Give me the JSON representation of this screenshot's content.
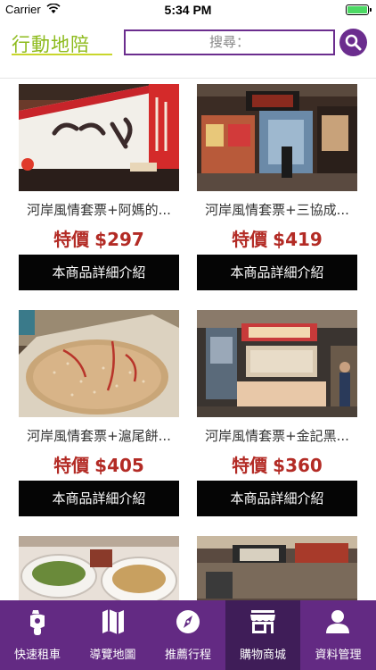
{
  "status_bar": {
    "carrier": "Carrier",
    "time": "5:34 PM"
  },
  "header": {
    "logo_text": "行動地陪",
    "search_placeholder": "搜尋："
  },
  "products": [
    {
      "name": "河岸風情套票+阿媽的...",
      "price_label": "特價",
      "price": "$297",
      "button": "本商品詳細介紹",
      "image": "shop-sign"
    },
    {
      "name": "河岸風情套票+三協成...",
      "price_label": "特價",
      "price": "$419",
      "button": "本商品詳細介紹",
      "image": "shop-front"
    },
    {
      "name": "河岸風情套票+滬尾餅...",
      "price_label": "特價",
      "price": "$405",
      "button": "本商品詳細介紹",
      "image": "cake"
    },
    {
      "name": "河岸風情套票+金記黑...",
      "price_label": "特價",
      "price": "$360",
      "button": "本商品詳細介紹",
      "image": "store-counter"
    }
  ],
  "tabs": [
    {
      "label": "快速租車",
      "icon": "scooter-icon"
    },
    {
      "label": "導覽地圖",
      "icon": "map-icon"
    },
    {
      "label": "推薦行程",
      "icon": "compass-icon"
    },
    {
      "label": "購物商城",
      "icon": "store-icon",
      "active": true
    },
    {
      "label": "資料管理",
      "icon": "user-icon"
    }
  ],
  "colors": {
    "brand_purple": "#632a83",
    "active_tab": "#3f1d58",
    "price_red": "#b32b25",
    "logo_green": "#8dbb1c"
  }
}
